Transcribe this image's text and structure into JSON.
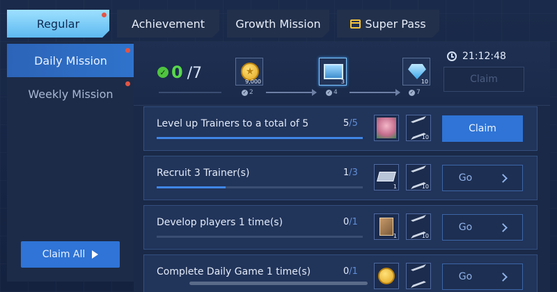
{
  "tabs": [
    {
      "label": "Regular",
      "active": true,
      "badge": true
    },
    {
      "label": "Achievement",
      "active": false
    },
    {
      "label": "Growth Mission",
      "active": false
    },
    {
      "label": "Super Pass",
      "active": false,
      "icon": "calendar-pass-icon"
    }
  ],
  "sidebar": {
    "items": [
      {
        "label": "Daily Mission",
        "active": true,
        "badge": true
      },
      {
        "label": "Weekly Mission",
        "active": false,
        "badge": true
      }
    ],
    "claim_all_label": "Claim All"
  },
  "progress": {
    "current": "0",
    "total": "/7",
    "timer": "21:12:48",
    "claim_label": "Claim",
    "rewards": [
      {
        "icon": "gold-coin-icon",
        "quantity": "9,000",
        "requirement": "2"
      },
      {
        "icon": "chest-icon",
        "quantity": "3",
        "requirement": "4"
      },
      {
        "icon": "diamond-icon",
        "quantity": "10",
        "requirement": "7"
      }
    ]
  },
  "missions": [
    {
      "title": "Level up Trainers to a total of 5",
      "done": "5",
      "sep": "/",
      "target": "5",
      "progress": 1.0,
      "reward1_qty": "",
      "reward2_qty": "10",
      "button": "Claim"
    },
    {
      "title": "Recruit 3 Trainer(s)",
      "done": "1",
      "sep": "/",
      "target": "3",
      "progress": 0.333,
      "reward1_qty": "1",
      "reward2_qty": "10",
      "button": "Go"
    },
    {
      "title": "Develop players 1 time(s)",
      "done": "0",
      "sep": "/",
      "target": "1",
      "progress": 0.0,
      "reward1_qty": "1",
      "reward2_qty": "10",
      "button": "Go"
    },
    {
      "title": "Complete Daily Game 1 time(s)",
      "done": "0",
      "sep": "/",
      "target": "1",
      "progress": 0.0,
      "reward1_qty": "",
      "reward2_qty": "",
      "button": "Go"
    }
  ],
  "colors": {
    "accent": "#2f74d6",
    "active_tab": "#6fc6f5",
    "badge": "#e25544",
    "complete": "#4fc43f"
  }
}
